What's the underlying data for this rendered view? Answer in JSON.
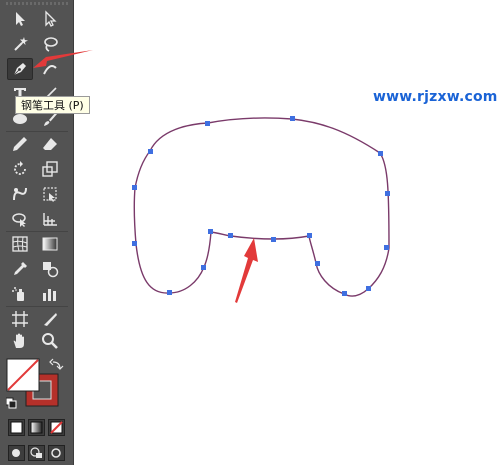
{
  "tooltip": {
    "text": "钢笔工具 (P)"
  },
  "watermark": {
    "text": "www.rjzxw.com"
  },
  "colors": {
    "toolbar_bg": "#535353",
    "path_stroke": "#7a3a6a",
    "anchor": "#3f6fe0",
    "arrow": "#e23a3a",
    "watermark": "#1a63d6",
    "stroke_swatch": "#b5302a"
  },
  "tools": [
    {
      "name": "selection-tool",
      "icon": "arrow-icon"
    },
    {
      "name": "direct-selection-tool",
      "icon": "hollow-arrow-icon"
    },
    {
      "name": "magic-wand-tool",
      "icon": "magic-wand-icon"
    },
    {
      "name": "lasso-tool",
      "icon": "lasso-icon"
    },
    {
      "name": "pen-tool",
      "icon": "pen-icon",
      "selected": true
    },
    {
      "name": "curvature-tool",
      "icon": "curvature-icon"
    },
    {
      "name": "type-tool",
      "icon": "type-icon"
    },
    {
      "name": "line-tool",
      "icon": "line-icon"
    },
    {
      "name": "ellipse-tool",
      "icon": "ellipse-icon"
    },
    {
      "name": "paintbrush-tool",
      "icon": "brush-icon"
    },
    {
      "name": "pencil-tool",
      "icon": "pencil-icon"
    },
    {
      "name": "eraser-tool",
      "icon": "eraser-icon"
    },
    {
      "name": "rotate-tool",
      "icon": "rotate-icon"
    },
    {
      "name": "scale-tool",
      "icon": "scale-icon"
    },
    {
      "name": "warp-tool",
      "icon": "warp-icon"
    },
    {
      "name": "free-transform-tool",
      "icon": "free-transform-icon"
    },
    {
      "name": "shape-builder-tool",
      "icon": "shape-builder-icon"
    },
    {
      "name": "perspective-grid-tool",
      "icon": "perspective-icon"
    },
    {
      "name": "mesh-tool",
      "icon": "mesh-icon"
    },
    {
      "name": "gradient-tool",
      "icon": "gradient-icon"
    },
    {
      "name": "eyedropper-tool",
      "icon": "eyedropper-icon"
    },
    {
      "name": "blend-tool",
      "icon": "blend-icon"
    },
    {
      "name": "symbol-sprayer-tool",
      "icon": "spray-icon"
    },
    {
      "name": "column-graph-tool",
      "icon": "graph-icon"
    },
    {
      "name": "artboard-tool",
      "icon": "artboard-icon"
    },
    {
      "name": "slice-tool",
      "icon": "slice-icon"
    },
    {
      "name": "hand-tool",
      "icon": "hand-icon"
    },
    {
      "name": "zoom-tool",
      "icon": "zoom-icon"
    }
  ]
}
